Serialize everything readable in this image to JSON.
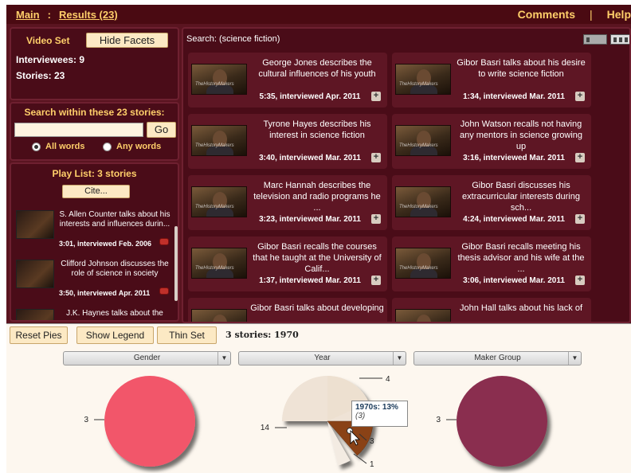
{
  "nav": {
    "main": "Main",
    "separator": ":",
    "results": "Results (23)",
    "comments": "Comments",
    "divider": "|",
    "help": "Help"
  },
  "facets": {
    "video_set_label": "Video Set",
    "hide_facets": "Hide Facets",
    "interviewees": "Interviewees: 9",
    "stories": "Stories: 23"
  },
  "search_within": {
    "title": "Search within these 23 stories:",
    "value": "",
    "go": "Go",
    "all_words": "All words",
    "any_words": "Any words"
  },
  "playlist": {
    "title": "Play List: 3 stories",
    "cite": "Cite...",
    "items": [
      {
        "title": "S. Allen Counter talks about his interests and influences durin...",
        "meta": "3:01, interviewed Feb. 2006"
      },
      {
        "title": "Clifford Johnson discusses the role of science in society",
        "meta": "3:50, interviewed Apr. 2011"
      },
      {
        "title": "J.K. Haynes talks about the",
        "meta": ""
      }
    ]
  },
  "results": {
    "search_label": "Search: (science fiction)",
    "cards": [
      {
        "title": "George Jones describes the cultural influences of his youth",
        "meta": "5:35, interviewed Apr. 2011"
      },
      {
        "title": "Gibor Basri talks about his desire to write science fiction",
        "meta": "1:34, interviewed Mar. 2011"
      },
      {
        "title": "Tyrone Hayes describes his interest in science fiction",
        "meta": "3:40, interviewed Mar. 2011"
      },
      {
        "title": "John Watson recalls not having any mentors in science growing up",
        "meta": "3:16, interviewed Mar. 2011"
      },
      {
        "title": "Marc Hannah describes the television and radio programs he ...",
        "meta": "3:23, interviewed Mar. 2011"
      },
      {
        "title": "Gibor Basri discusses his extracurricular interests during sch...",
        "meta": "4:24, interviewed Mar. 2011"
      },
      {
        "title": "Gibor Basri recalls the courses that he taught at the University of Calif...",
        "meta": "1:37, interviewed Mar. 2011"
      },
      {
        "title": "Gibor Basri recalls meeting his thesis advisor and his wife at the ...",
        "meta": "3:06, interviewed Mar. 2011"
      },
      {
        "title": "Gibor Basri talks about developing",
        "meta": ""
      },
      {
        "title": "John Hall talks about his lack of",
        "meta": ""
      }
    ],
    "thumb_watermark": "TheHistoryMakers",
    "plus": "+"
  },
  "bottom": {
    "reset_pies": "Reset Pies",
    "show_legend": "Show Legend",
    "thin_set": "Thin Set",
    "summary": "3 stories: 1970",
    "selects": {
      "gender": "Gender",
      "year": "Year",
      "maker_group": "Maker Group"
    },
    "select_arrow": "▼"
  },
  "chart_data": [
    {
      "type": "pie",
      "facet": "Gender",
      "slices": [
        {
          "value": 3,
          "color": "#f2566a"
        }
      ],
      "labels": [
        "3"
      ]
    },
    {
      "type": "pie",
      "facet": "Year",
      "slices": [
        {
          "label": "14",
          "value": 14,
          "color": "#efe3d6"
        },
        {
          "label": "4",
          "value": 4,
          "color": "#ede0d0"
        },
        {
          "label": "1970s",
          "value": 3,
          "color": "#8a4216",
          "selected": true
        },
        {
          "label": "1",
          "value": 1,
          "color": "#f3ebe2"
        }
      ],
      "tooltip": {
        "title": "1970s:  13%",
        "sub": "(3)"
      }
    },
    {
      "type": "pie",
      "facet": "Maker Group",
      "slices": [
        {
          "value": 3,
          "color": "#8a2e50"
        }
      ],
      "labels": [
        "3"
      ]
    }
  ]
}
